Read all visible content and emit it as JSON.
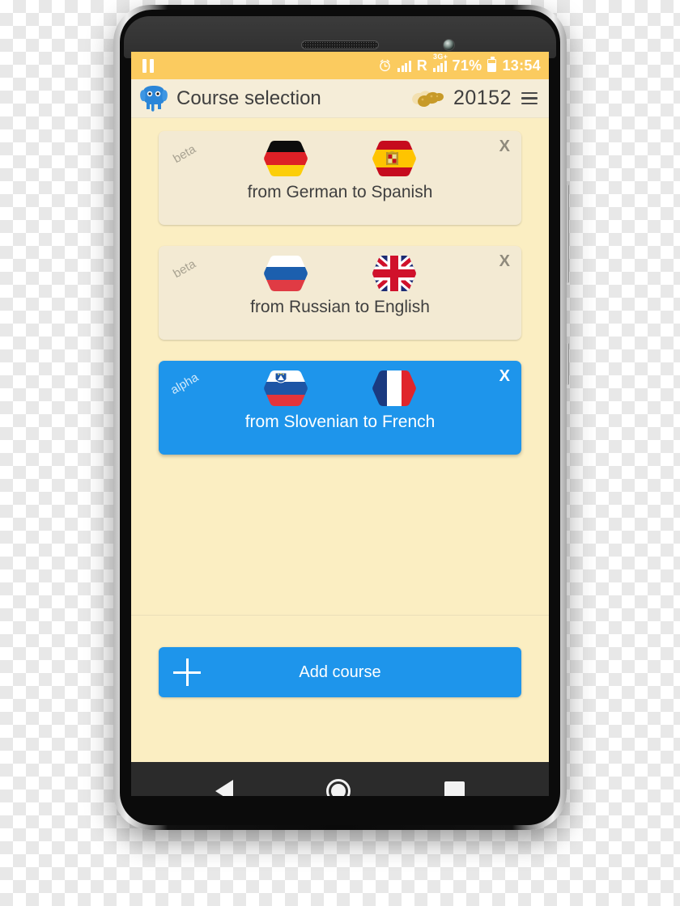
{
  "statusbar": {
    "pause_icon": "pause-icon",
    "alarm_icon": "alarm-clock-icon",
    "signal_icon": "cellular-signal-icon",
    "roaming_label": "R",
    "network_type": "3G+",
    "battery_percent": "71%",
    "battery_icon": "battery-icon",
    "time": "13:54"
  },
  "appbar": {
    "logo_icon": "elephant-icon",
    "title": "Course selection",
    "coin_icon": "peanut-coin-icon",
    "coin_count": "20152",
    "menu_icon": "hamburger-menu-icon"
  },
  "courses": [
    {
      "stage": "beta",
      "source_flag": "german-flag-icon",
      "target_flag": "spanish-flag-icon",
      "name": "from German to Spanish",
      "close_label": "X",
      "selected": false
    },
    {
      "stage": "beta",
      "source_flag": "russian-flag-icon",
      "target_flag": "english-flag-icon",
      "name": "from Russian to English",
      "close_label": "X",
      "selected": false
    },
    {
      "stage": "alpha",
      "source_flag": "slovenian-flag-icon",
      "target_flag": "french-flag-icon",
      "name": "from Slovenian to French",
      "close_label": "X",
      "selected": true
    }
  ],
  "add_course": {
    "plus_icon": "plus-icon",
    "label": "Add course"
  },
  "navbar": {
    "back_icon": "back-triangle-icon",
    "home_icon": "home-circle-icon",
    "recents_icon": "recents-square-icon"
  },
  "colors": {
    "status_bar": "#fbcb5f",
    "app_bar": "#f5edd8",
    "background": "#fbeec2",
    "card": "#f3ead3",
    "accent": "#1e95eb",
    "text": "#3f3f3f"
  }
}
